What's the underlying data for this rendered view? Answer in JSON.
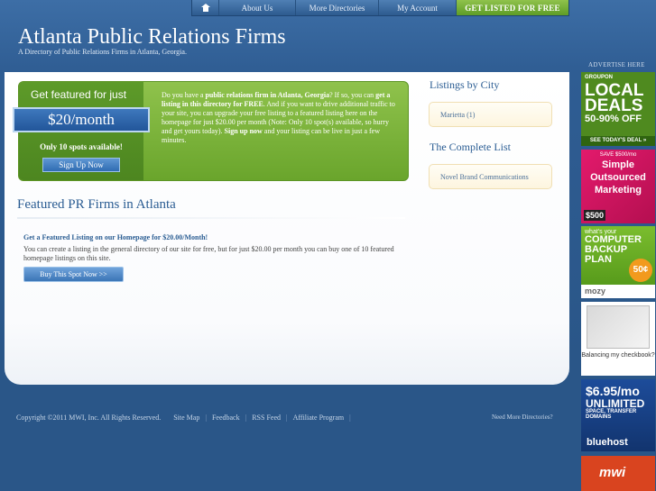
{
  "nav": {
    "home_icon": "home-icon",
    "about": "About Us",
    "more_directories": "More Directories",
    "my_account": "My Account",
    "get_listed": "GET LISTED FOR FREE"
  },
  "header": {
    "title": "Atlanta Public Relations Firms",
    "subtitle": "A Directory of Public Relations Firms in Atlanta, Georgia.",
    "advertise": "ADVERTISE HERE"
  },
  "featured_box": {
    "title": "Get featured for just",
    "price": "$20/month",
    "spots": "Only 10 spots available!",
    "signup_button": "Sign Up Now",
    "text_1": "Do you have a ",
    "text_bold_1": "public relations firm in Atlanta, Georgia",
    "text_2": "? If so, you can ",
    "text_bold_2": "get a listing in this directory for FREE",
    "text_3": ". And if you want to drive additional traffic to your site, you can upgrade your free listing to a featured listing here on the homepage for just $20.00 per month (Note: Only 10 spot(s) available, so hurry and get yours today). ",
    "text_bold_3": "Sign up now",
    "text_4": " and your listing can be live in just a few minutes."
  },
  "featured_section": {
    "title": "Featured PR Firms in Atlanta",
    "cta_heading": "Get a Featured Listing on our Homepage for $20.00/Month!",
    "cta_body": "You can create a listing in the general directory of our site for free, but for just $20.00 per month you can buy one of 10 featured homepage listings on this site.",
    "buy_button": "Buy This Spot Now >>"
  },
  "sidebar": {
    "listings_heading": "Listings by City",
    "city_link": "Marietta",
    "city_count": "(1)",
    "complete_heading": "The Complete List",
    "firm_link": "Novel Brand Communications"
  },
  "footer": {
    "copyright": "Copyright ©2011 MWI, Inc. All Rights Reserved.",
    "links": [
      "Site Map",
      "Feedback",
      "RSS Feed",
      "Affiliate Program"
    ],
    "need_more": "Need More Directories?"
  },
  "ads": {
    "groupon": {
      "brand": "GROUPON",
      "line1": "LOCAL",
      "line2": "DEALS",
      "pct": "50-90% OFF",
      "bar": "SEE TODAY'S DEAL »"
    },
    "marketing": {
      "save": "SAVE $500/mo",
      "line1": "Simple",
      "line2": "Outsourced",
      "line3": "Marketing",
      "foot": "$500"
    },
    "mozy": {
      "small": "what's your",
      "line1": "COMPUTER",
      "line2": "BACKUP",
      "line3": "PLAN",
      "badge": "50¢",
      "logo": "mozy"
    },
    "checkbook": {
      "caption": "Balancing my checkbook?"
    },
    "bluehost": {
      "price": "$6.95/mo",
      "line1": "UNLIMITED",
      "sub": "SPACE, TRANSFER DOMAINS",
      "logo": "bluehost"
    },
    "mwi": {
      "logo": "mwi"
    }
  }
}
